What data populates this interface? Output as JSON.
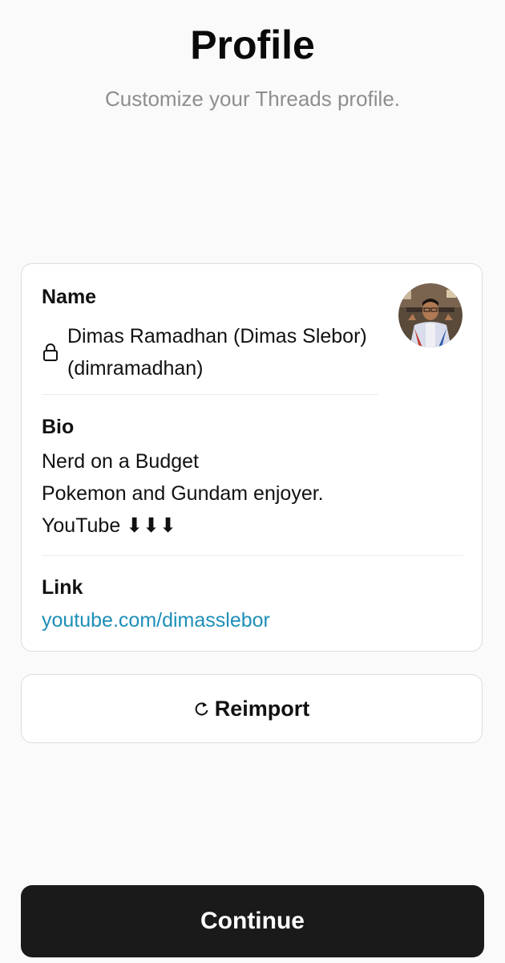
{
  "header": {
    "title": "Profile",
    "subtitle": "Customize your Threads profile."
  },
  "profile_card": {
    "name_label": "Name",
    "name_value": "Dimas Ramadhan (Dimas Slebor) (dimramadhan)",
    "name_icon": "lock-icon",
    "bio_label": "Bio",
    "bio_lines": [
      "Nerd on a Budget",
      "Pokemon and Gundam enjoyer.",
      "YouTube ⬇⬇⬇"
    ],
    "link_label": "Link",
    "link_value": "youtube.com/dimasslebor",
    "avatar": "profile-photo"
  },
  "actions": {
    "reimport_label": "Reimport",
    "reimport_icon": "refresh-icon",
    "continue_label": "Continue"
  },
  "colors": {
    "background": "#fafafa",
    "link": "#1d8fb8",
    "primary_button": "#1a1a1a",
    "subtitle": "#8e8e8e"
  }
}
